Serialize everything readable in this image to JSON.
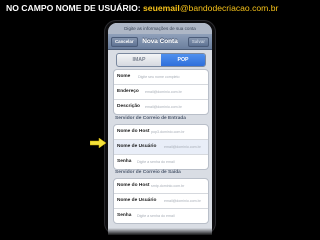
{
  "caption": {
    "prefix": "NO CAMPO NOME DE USUÁRIO: ",
    "email_user": "seuemail",
    "email_domain": "@bandodecriacao.com.br"
  },
  "prompt": "Digite as informações de sua conta",
  "navbar": {
    "cancel": "Cancelar",
    "title": "Nova Conta",
    "save": "Salvar"
  },
  "segments": [
    {
      "label": "IMAP",
      "selected": false
    },
    {
      "label": "POP",
      "selected": true
    }
  ],
  "account": {
    "rows": [
      {
        "label": "Nome",
        "placeholder": "Digite seu nome completo"
      },
      {
        "label": "Endereço",
        "placeholder": "email@dominio.com.br"
      },
      {
        "label": "Descrição",
        "placeholder": "email@dominio.com.br"
      }
    ]
  },
  "incoming": {
    "header": "Servidor de Correio de Entrada",
    "rows": [
      {
        "label": "Nome do Host",
        "placeholder": "pop3.dominio.com.br"
      },
      {
        "label": "Nome de Usuário",
        "placeholder": "email@dominio.com.br"
      },
      {
        "label": "Senha",
        "placeholder": "Digite a senha do email"
      }
    ]
  },
  "outgoing": {
    "header": "Servidor de Correio de Saída",
    "rows": [
      {
        "label": "Nome do Host",
        "placeholder": "smtp.dominio.com.br"
      },
      {
        "label": "Nome de Usuário",
        "placeholder": "email@dominio.com.br"
      },
      {
        "label": "Senha",
        "placeholder": "Digite a senha do email"
      }
    ]
  },
  "colors": {
    "arrow": "#f5e23a",
    "accent": "#f6c21a",
    "segment_active": "#3b7fe5",
    "navbar": "#7d8fac"
  }
}
